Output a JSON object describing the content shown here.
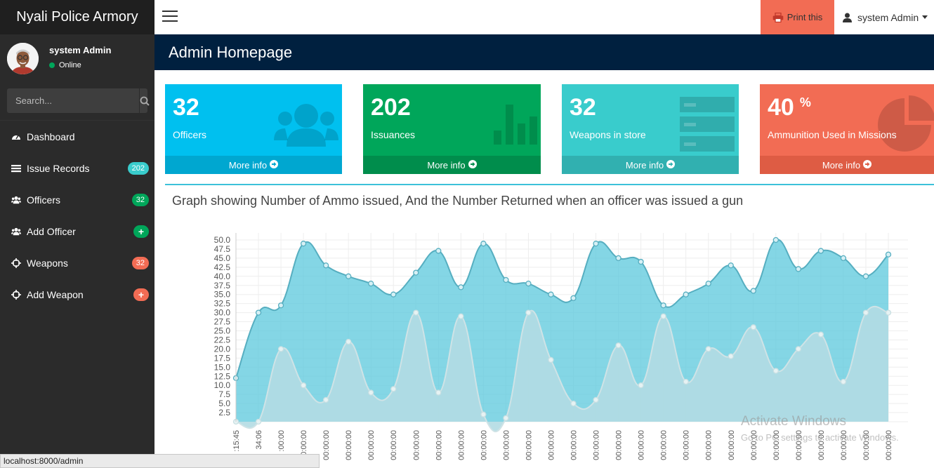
{
  "app": {
    "title": "Nyali Police Armory"
  },
  "user": {
    "name": "system Admin",
    "status": "Online"
  },
  "search": {
    "placeholder": "Search..."
  },
  "menu": [
    {
      "label": "Dashboard",
      "icon": "dashboard-icon",
      "badge": "",
      "badge_color": ""
    },
    {
      "label": "Issue Records",
      "icon": "list-icon",
      "badge": "202",
      "badge_color": "#39cccc"
    },
    {
      "label": "Officers",
      "icon": "users-icon",
      "badge": "32",
      "badge_color": "#00a65a"
    },
    {
      "label": "Add Officer",
      "icon": "users-icon",
      "badge": "+",
      "badge_color": "#00a65a"
    },
    {
      "label": "Weapons",
      "icon": "crosshairs-icon",
      "badge": "32",
      "badge_color": "#f26c54"
    },
    {
      "label": "Add Weapon",
      "icon": "crosshairs-icon",
      "badge": "+",
      "badge_color": "#f26c54"
    }
  ],
  "topbar": {
    "print_label": "Print this",
    "user_label": "system Admin"
  },
  "page": {
    "header": "Admin Homepage"
  },
  "stats": [
    {
      "value": "32",
      "suffix": "",
      "label": "Officers",
      "more": "More info",
      "color": "#00c0ef",
      "footer_color": "#00a7d0",
      "icon": "users-icon"
    },
    {
      "value": "202",
      "suffix": "",
      "label": "Issuances",
      "more": "More info",
      "color": "#00a65a",
      "footer_color": "#008d4c",
      "icon": "bar-chart-icon"
    },
    {
      "value": "32",
      "suffix": "",
      "label": "Weapons in store",
      "more": "More info",
      "color": "#39cccc",
      "footer_color": "#31b0b0",
      "icon": "server-icon"
    },
    {
      "value": "40",
      "suffix": "%",
      "label": "Ammunition Used in Missions",
      "more": "More info",
      "color": "#f26c54",
      "footer_color": "#de5c44",
      "icon": "pie-chart-icon"
    }
  ],
  "chart_title": "Graph showing Number of Ammo issued, And the Number Returned when an officer was issued a gun",
  "chart_data": {
    "type": "area",
    "ylim": [
      0,
      50
    ],
    "yticks": [
      "2.5",
      "5.0",
      "7.5",
      "10.0",
      "12.5",
      "15.0",
      "17.5",
      "20.0",
      "22.5",
      "25.0",
      "27.5",
      "30.0",
      "32.5",
      "35.0",
      "37.5",
      "40.0",
      "42.5",
      "45.0",
      "47.5",
      "50.0"
    ],
    "x": [
      ":15:45",
      "34:06",
      ":00:00",
      "00:00:00",
      "00:00:00",
      "00:00:00",
      "00:00:00",
      "00:00:00",
      "00:00:00",
      "00:00:00",
      "00:00:00",
      "00:00:00",
      "00:00:00",
      "00:00:00",
      "00:00:00",
      "00:00:00",
      "00:00:00",
      "00:00:00",
      "00:00:00",
      "00:00:00",
      "00:00:00",
      "00:00:00",
      "00:00:00",
      "00:00:00",
      "00:00:00",
      "00:00:00",
      "00:00:00",
      "00:00:00",
      "00:00:00",
      "00:00:00"
    ],
    "series": [
      {
        "values": [
          12,
          30,
          32,
          49,
          43,
          40,
          38,
          35,
          41,
          47,
          37,
          49,
          39,
          38,
          35,
          34,
          49,
          45,
          44,
          32,
          35,
          38,
          43,
          36,
          50,
          42,
          47,
          45,
          40,
          46
        ],
        "color": "#5bc8dc"
      },
      {
        "values": [
          0,
          0,
          20,
          10,
          6,
          22,
          8,
          9,
          30,
          8,
          29,
          2,
          1,
          30,
          17,
          5,
          6,
          21,
          10,
          29,
          11,
          20,
          18,
          26,
          14,
          20,
          24,
          11,
          30,
          30
        ],
        "color": "#b3dce3"
      }
    ]
  },
  "browser": {
    "status_url": "localhost:8000/admin"
  },
  "watermark": {
    "line1": "Activate Windows",
    "line2": "Go to PC settings to activate Windows."
  }
}
